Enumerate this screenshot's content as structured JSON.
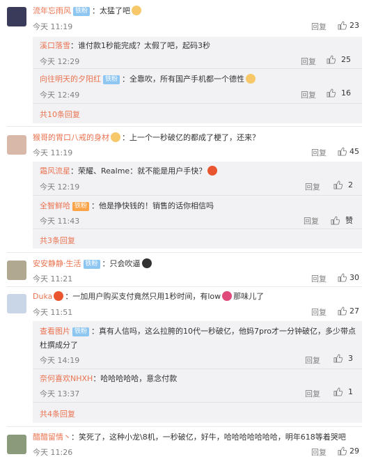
{
  "comments": [
    {
      "user": "流年忘雨风",
      "badge": "铁粉",
      "text": "：太猛了吧",
      "time": "今天 11:19",
      "reply": "回复",
      "likes": "23",
      "avatar_color": "#3a3a5a",
      "replies": [
        {
          "user": "溪口落雪",
          "text": "：谁付款1秒能完成？太假了吧，起码3秒",
          "time": "今天 12:29",
          "reply": "回复",
          "likes": "25"
        },
        {
          "user": "向往明天的夕阳红",
          "badge": "铁粉",
          "text": "：全靠吹，所有国产手机都一个德性",
          "time": "今天 12:49",
          "reply": "回复",
          "likes": "16"
        }
      ],
      "expand": "共10条回复"
    },
    {
      "user": "猴哥的胃口八戒的身材",
      "text": "：上一个一秒破亿的都成了梗了，还来？",
      "time": "今天 11:19",
      "reply": "回复",
      "likes": "45",
      "avatar_color": "#d8b8a8",
      "replies": [
        {
          "user": "霜风流星",
          "text": "：荣耀、Realme：就不能是用户手快？",
          "time": "今天 12:19",
          "reply": "回复",
          "likes": "2"
        },
        {
          "user": "全智鲜哈",
          "badge": "铁粉",
          "text": "：他是挣快钱的！销售的话你相信吗",
          "time": "今天 11:43",
          "reply": "回复",
          "likes": "赞"
        }
      ],
      "expand": "共3条回复"
    },
    {
      "user": "安安静静·生活",
      "badge": "铁粉",
      "text": "：只会吹逼",
      "time": "今天 11:21",
      "reply": "回复",
      "likes": "30",
      "avatar_color": "#b0a890"
    },
    {
      "user": "Duka",
      "text": "：一加用户购买支付竟然只用1秒时间，有low",
      "text_tail": "那味儿了",
      "time": "今天 11:51",
      "reply": "回复",
      "likes": "27",
      "avatar_color": "#c9d6e8",
      "replies": [
        {
          "user": "查看图片",
          "badge": "铁粉",
          "text": "：真有人信吗，这么拉胯的10代一秒破亿，他妈7pro才一分钟破亿，多少带点",
          "text2": "杜撰成分了",
          "time": "今天 14:19",
          "reply": "回复",
          "likes": "3"
        },
        {
          "user": "奈何喜欢NHXH",
          "text": "：哈哈哈哈哈，意念付款",
          "time": "今天 13:37",
          "reply": "回复",
          "likes": "1"
        }
      ],
      "expand": "共4条回复"
    },
    {
      "user": "醋醋留情丶",
      "text": "：笑死了，这种小龙\\8机，一秒破亿，好牛，哈哈哈哈哈哈哈，明年618等着哭吧",
      "time": "今天 11:26",
      "reply": "回复",
      "likes": "29",
      "avatar_color": "#8a9a7a"
    }
  ]
}
